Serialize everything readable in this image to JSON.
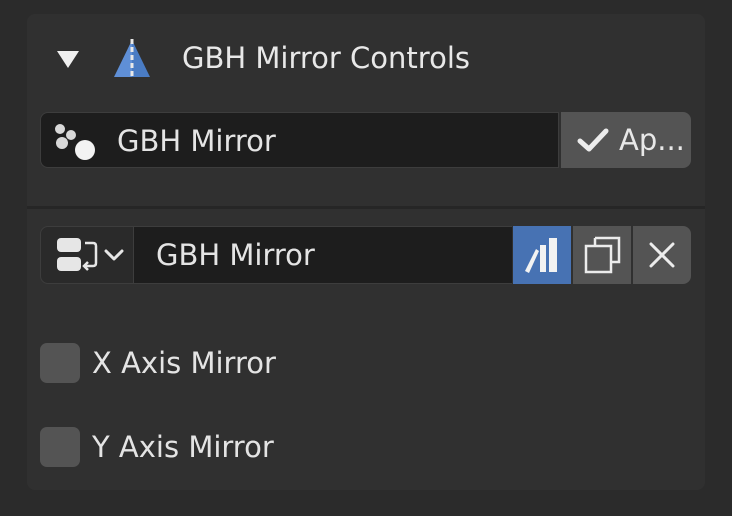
{
  "panel": {
    "title": "GBH Mirror Controls",
    "collapse_icon": "triangle-down-icon",
    "panel_icon": "mirror-triangle-icon"
  },
  "node_tree": {
    "icon": "node-dots-icon",
    "value": "GBH Mirror",
    "apply_icon": "checkmark-icon",
    "apply_label": "Ap..."
  },
  "datablock": {
    "browse_icon": "modifier-browse-icon",
    "dropdown_icon": "chevron-down-icon",
    "value": "GBH Mirror",
    "fake_user_icon": "library-books-icon",
    "duplicate_icon": "duplicate-icon",
    "unlink_icon": "close-icon"
  },
  "options": [
    {
      "label": "X Axis Mirror",
      "checked": false
    },
    {
      "label": "Y Axis Mirror",
      "checked": false
    }
  ],
  "colors": {
    "accent": "#4772b3",
    "panel_bg": "#303030",
    "field_bg": "#1d1d1d",
    "button_bg": "#545454"
  }
}
